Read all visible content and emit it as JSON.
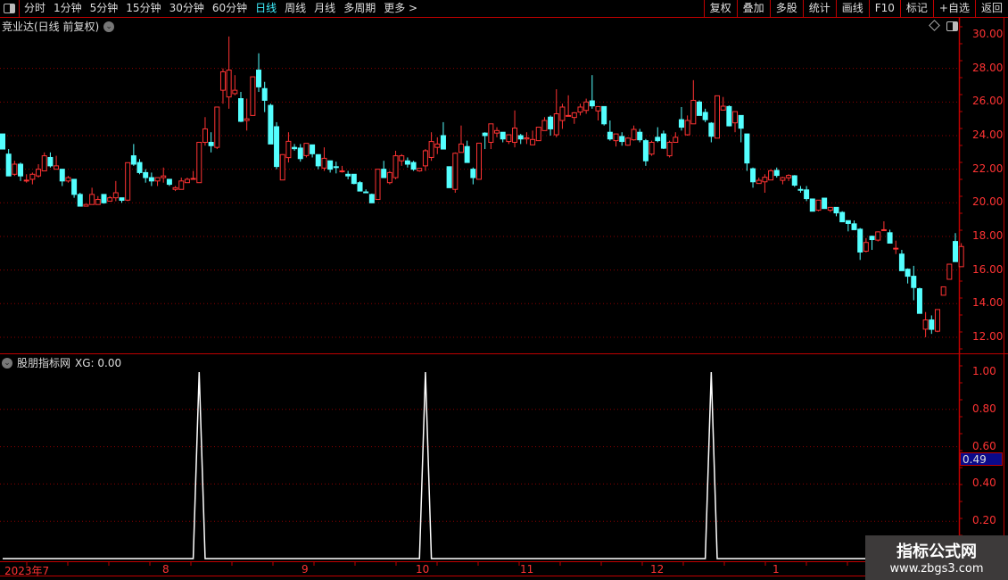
{
  "toolbar": {
    "periods": [
      "分时",
      "1分钟",
      "5分钟",
      "15分钟",
      "30分钟",
      "60分钟",
      "日线",
      "周线",
      "月线",
      "多周期",
      "更多 >"
    ],
    "active_period": "日线",
    "right_buttons": [
      "复权",
      "叠加",
      "多股",
      "统计",
      "画线",
      "F10",
      "标记",
      "+自选",
      "返回"
    ]
  },
  "main": {
    "title": "竞业达(日线 前复权)",
    "price_ticks": [
      "30.00",
      "28.00",
      "26.00",
      "24.00",
      "22.00",
      "20.00",
      "18.00",
      "16.00",
      "14.00",
      "12.00"
    ]
  },
  "indicator": {
    "title": "股朋指标网",
    "xg_readout": "XG: 0.00",
    "ticks": [
      "1.00",
      "0.80",
      "0.60",
      "0.40",
      "0.20"
    ],
    "current_value_label": "0.49",
    "xg_signal_candles": [
      33,
      71,
      119
    ]
  },
  "time_axis": {
    "labels": [
      "2023年7",
      "8",
      "9",
      "10",
      "11",
      "12",
      "1"
    ]
  },
  "watermark": {
    "name": "指标公式网",
    "url": "www.zbgs3.com"
  },
  "colors": {
    "up": "#ff3333",
    "down": "#54ffff",
    "grid": "#8b0000",
    "axis": "#c00000",
    "active": "#3ff0ff"
  },
  "chart_data": {
    "type": "candlestick",
    "ylim": [
      12,
      30
    ],
    "indicator_ylim": [
      0,
      1
    ],
    "ohlc": [
      [
        24.1,
        24.1,
        23.2,
        23.2
      ],
      [
        22.9,
        23.2,
        21.6,
        21.6
      ],
      [
        21.7,
        22.5,
        21.6,
        22.3
      ],
      [
        22.3,
        22.4,
        21.3,
        21.6
      ],
      [
        21.3,
        21.7,
        21.2,
        21.35
      ],
      [
        21.4,
        21.8,
        21.1,
        21.7
      ],
      [
        21.6,
        22.3,
        21.5,
        22.0
      ],
      [
        21.9,
        23.0,
        21.9,
        22.8
      ],
      [
        22.7,
        23.0,
        22.1,
        22.2
      ],
      [
        22.0,
        22.8,
        22.0,
        22.2
      ],
      [
        22.0,
        22.0,
        21.0,
        21.3
      ],
      [
        21.3,
        21.6,
        21.2,
        21.5
      ],
      [
        21.4,
        21.4,
        20.3,
        20.5
      ],
      [
        20.5,
        20.6,
        19.8,
        19.8
      ],
      [
        19.8,
        19.95,
        19.8,
        19.9
      ],
      [
        19.9,
        20.9,
        19.9,
        20.5
      ],
      [
        19.9,
        20.4,
        19.9,
        20.2
      ],
      [
        20.5,
        20.5,
        19.95,
        20.0
      ],
      [
        20.1,
        20.4,
        20.1,
        20.3
      ],
      [
        20.3,
        21.3,
        20.1,
        20.6
      ],
      [
        20.3,
        20.3,
        20.0,
        20.15
      ],
      [
        20.16,
        22.39,
        20.1,
        22.39
      ],
      [
        22.8,
        23.5,
        22.2,
        22.3
      ],
      [
        22.4,
        22.6,
        21.7,
        21.8
      ],
      [
        21.8,
        22.0,
        21.2,
        21.5
      ],
      [
        21.5,
        21.8,
        21.0,
        21.3
      ],
      [
        21.3,
        21.5,
        21.0,
        21.5
      ],
      [
        21.5,
        22.1,
        21.2,
        21.6
      ],
      [
        21.4,
        21.4,
        21.0,
        21.1
      ],
      [
        20.8,
        21.0,
        20.7,
        20.9
      ],
      [
        20.8,
        21.5,
        20.8,
        21.3
      ],
      [
        21.2,
        21.5,
        21.2,
        21.4
      ],
      [
        21.4,
        21.9,
        21.4,
        21.45
      ],
      [
        21.2,
        23.6,
        21.2,
        23.6
      ],
      [
        23.6,
        25.1,
        23.4,
        24.4
      ],
      [
        23.6,
        24.2,
        23.0,
        23.4
      ],
      [
        23.3,
        25.7,
        23.2,
        25.7
      ],
      [
        26.7,
        28.0,
        25.9,
        27.8
      ],
      [
        26.3,
        29.9,
        25.6,
        27.9
      ],
      [
        26.5,
        27.6,
        26.4,
        26.7
      ],
      [
        26.2,
        26.6,
        24.8,
        24.85
      ],
      [
        24.9,
        26.2,
        24.3,
        25.0
      ],
      [
        25.2,
        27.5,
        25.2,
        27.5
      ],
      [
        27.9,
        28.9,
        26.6,
        26.9
      ],
      [
        26.8,
        27.2,
        25.4,
        26.1
      ],
      [
        25.8,
        25.9,
        23.5,
        23.5
      ],
      [
        24.53,
        24.8,
        22.0,
        22.16
      ],
      [
        21.36,
        22.9,
        21.36,
        22.87
      ],
      [
        22.69,
        24.2,
        22.4,
        23.66
      ],
      [
        23.3,
        23.5,
        23.1,
        23.22
      ],
      [
        23.26,
        23.5,
        22.45,
        22.63
      ],
      [
        22.81,
        23.54,
        22.7,
        23.54
      ],
      [
        23.45,
        23.45,
        22.7,
        22.92
      ],
      [
        22.87,
        22.87,
        22.0,
        22.2
      ],
      [
        22.07,
        23.3,
        21.9,
        22.65
      ],
      [
        22.5,
        22.5,
        21.8,
        22.0
      ],
      [
        22.15,
        22.45,
        21.75,
        22.1
      ],
      [
        21.85,
        22.2,
        21.8,
        21.9
      ],
      [
        21.7,
        21.9,
        21.4,
        21.6
      ],
      [
        21.7,
        21.7,
        21.1,
        21.15
      ],
      [
        21.2,
        21.3,
        20.7,
        20.7
      ],
      [
        20.65,
        20.8,
        20.6,
        20.6
      ],
      [
        20.5,
        20.55,
        20.0,
        20.0
      ],
      [
        20.2,
        22.0,
        20.2,
        22.0
      ],
      [
        22.0,
        22.5,
        21.5,
        21.5
      ],
      [
        21.2,
        21.9,
        21.1,
        21.8
      ],
      [
        21.5,
        23.1,
        21.4,
        22.8
      ],
      [
        22.5,
        22.9,
        22.2,
        22.8
      ],
      [
        22.5,
        22.7,
        22.1,
        22.3
      ],
      [
        22.4,
        22.5,
        21.9,
        22.0
      ],
      [
        21.9,
        22.05,
        21.85,
        22.05
      ],
      [
        22.2,
        23.2,
        21.9,
        23.1
      ],
      [
        22.7,
        24.2,
        22.5,
        23.65
      ],
      [
        23.3,
        23.9,
        22.9,
        23.5
      ],
      [
        24.0,
        24.8,
        23.2,
        23.2
      ],
      [
        22.15,
        22.15,
        20.9,
        20.9
      ],
      [
        20.8,
        23.0,
        20.6,
        22.95
      ],
      [
        23.0,
        24.6,
        23.0,
        23.5
      ],
      [
        23.35,
        23.7,
        22.4,
        22.4
      ],
      [
        22.0,
        22.1,
        21.1,
        21.5
      ],
      [
        21.4,
        23.55,
        21.4,
        23.55
      ],
      [
        24.15,
        24.2,
        23.2,
        24.0
      ],
      [
        23.6,
        24.7,
        23.2,
        24.7
      ],
      [
        24.15,
        24.5,
        23.9,
        24.3
      ],
      [
        24.2,
        24.2,
        23.6,
        23.8
      ],
      [
        23.65,
        24.05,
        23.5,
        24.05
      ],
      [
        23.6,
        25.5,
        23.3,
        24.45
      ],
      [
        24.0,
        24.1,
        23.5,
        23.8
      ],
      [
        23.8,
        24.2,
        23.5,
        23.87
      ],
      [
        23.45,
        24.3,
        23.45,
        23.77
      ],
      [
        23.7,
        24.5,
        23.7,
        24.5
      ],
      [
        24.3,
        25.1,
        24.3,
        24.9
      ],
      [
        25.1,
        25.2,
        24.0,
        24.4
      ],
      [
        24.05,
        26.76,
        23.9,
        25.3
      ],
      [
        24.9,
        25.9,
        24.4,
        25.7
      ],
      [
        25.15,
        26.4,
        25.15,
        25.2
      ],
      [
        25.08,
        25.4,
        24.7,
        25.36
      ],
      [
        25.4,
        25.9,
        25.2,
        25.7
      ],
      [
        25.5,
        26.2,
        25.3,
        26.0
      ],
      [
        26.07,
        27.6,
        25.6,
        25.77
      ],
      [
        25.47,
        25.73,
        24.9,
        25.73
      ],
      [
        25.73,
        25.73,
        24.6,
        24.7
      ],
      [
        24.2,
        24.9,
        23.7,
        23.8
      ],
      [
        23.7,
        24.1,
        23.35,
        24.1
      ],
      [
        23.95,
        24.2,
        23.4,
        23.65
      ],
      [
        23.43,
        23.9,
        23.4,
        23.85
      ],
      [
        23.75,
        24.6,
        23.7,
        24.37
      ],
      [
        24.2,
        24.4,
        23.6,
        23.75
      ],
      [
        23.7,
        23.8,
        22.2,
        22.5
      ],
      [
        22.9,
        23.7,
        22.8,
        23.6
      ],
      [
        23.9,
        24.5,
        23.6,
        23.7
      ],
      [
        24.1,
        24.3,
        23.2,
        23.25
      ],
      [
        22.8,
        23.7,
        22.7,
        23.6
      ],
      [
        23.6,
        24.2,
        23.6,
        23.9
      ],
      [
        24.95,
        25.7,
        24.3,
        24.5
      ],
      [
        24.05,
        25.2,
        24.0,
        24.9
      ],
      [
        24.7,
        27.3,
        24.7,
        26.1
      ],
      [
        26.0,
        26.1,
        25.2,
        25.2
      ],
      [
        25.38,
        25.6,
        24.8,
        24.95
      ],
      [
        24.74,
        24.8,
        23.6,
        23.96
      ],
      [
        23.85,
        26.37,
        23.85,
        26.37
      ],
      [
        25.52,
        26.3,
        25.52,
        25.75
      ],
      [
        25.73,
        25.8,
        24.55,
        24.58
      ],
      [
        24.76,
        25.43,
        24.2,
        25.43
      ],
      [
        25.2,
        25.2,
        23.6,
        24.44
      ],
      [
        24.1,
        24.1,
        21.9,
        22.37
      ],
      [
        22.03,
        22.1,
        20.9,
        21.25
      ],
      [
        21.15,
        21.5,
        21.15,
        21.34
      ],
      [
        21.25,
        21.7,
        20.6,
        21.52
      ],
      [
        21.36,
        22.0,
        21.36,
        21.91
      ],
      [
        21.93,
        22.1,
        21.5,
        21.63
      ],
      [
        21.34,
        21.55,
        21.1,
        21.5
      ],
      [
        21.49,
        21.7,
        21.3,
        21.63
      ],
      [
        21.61,
        21.65,
        20.95,
        21.05
      ],
      [
        20.8,
        21.0,
        20.6,
        20.75
      ],
      [
        20.77,
        21.0,
        20.1,
        20.25
      ],
      [
        20.23,
        20.23,
        19.5,
        19.5
      ],
      [
        19.56,
        20.16,
        19.5,
        20.16
      ],
      [
        20.28,
        20.28,
        19.66,
        19.66
      ],
      [
        19.56,
        19.73,
        19.45,
        19.73
      ],
      [
        19.73,
        19.73,
        19.2,
        19.4
      ],
      [
        19.43,
        19.5,
        18.87,
        18.87
      ],
      [
        18.94,
        18.94,
        18.3,
        18.77
      ],
      [
        18.75,
        18.95,
        18.4,
        18.4
      ],
      [
        18.43,
        18.5,
        16.6,
        17.07
      ],
      [
        17.12,
        17.9,
        17.05,
        17.64
      ],
      [
        18.01,
        18.05,
        17.2,
        17.81
      ],
      [
        17.78,
        18.3,
        17.7,
        18.27
      ],
      [
        18.35,
        18.9,
        18.35,
        18.4
      ],
      [
        18.22,
        18.4,
        17.6,
        17.6
      ],
      [
        17.3,
        17.75,
        16.95,
        17.3
      ],
      [
        16.95,
        17.2,
        15.96,
        15.96
      ],
      [
        16.05,
        16.1,
        15.2,
        15.63
      ],
      [
        15.63,
        16.25,
        14.2,
        14.96
      ],
      [
        14.89,
        14.95,
        13.42,
        13.42
      ],
      [
        12.48,
        13.5,
        12.0,
        13.03
      ],
      [
        13.03,
        13.3,
        12.2,
        12.47
      ],
      [
        12.36,
        13.65,
        12.3,
        13.65
      ],
      [
        14.5,
        15.0,
        14.5,
        15.0
      ],
      [
        15.45,
        16.35,
        15.45,
        16.35
      ],
      [
        17.7,
        18.2,
        16.5,
        16.5
      ],
      [
        16.2,
        17.6,
        16.2,
        17.4
      ]
    ]
  }
}
